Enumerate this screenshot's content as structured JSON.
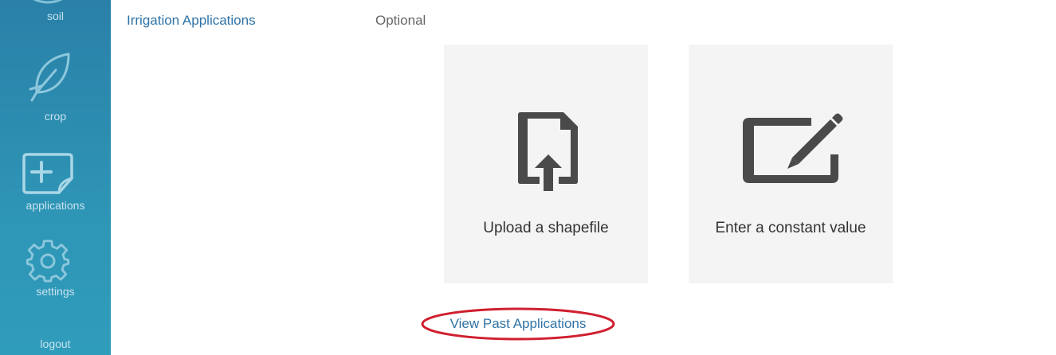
{
  "sidebar": {
    "items": [
      {
        "label": "soil",
        "icon": "soil-icon"
      },
      {
        "label": "crop",
        "icon": "leaf-icon"
      },
      {
        "label": "applications",
        "icon": "add-note-icon"
      },
      {
        "label": "settings",
        "icon": "gear-icon"
      },
      {
        "label": "logout"
      }
    ]
  },
  "main": {
    "row_title": "Irrigation Applications",
    "row_status": "Optional",
    "options": [
      {
        "label": "Upload a shapefile",
        "icon": "upload-file-icon"
      },
      {
        "label": "Enter a constant value",
        "icon": "edit-icon"
      }
    ],
    "past_link": "View Past Applications"
  },
  "colors": {
    "sidebar": "#2e8fb3",
    "link": "#2f73a6",
    "card_bg": "#f4f4f4",
    "highlight": "#d01f2f"
  }
}
